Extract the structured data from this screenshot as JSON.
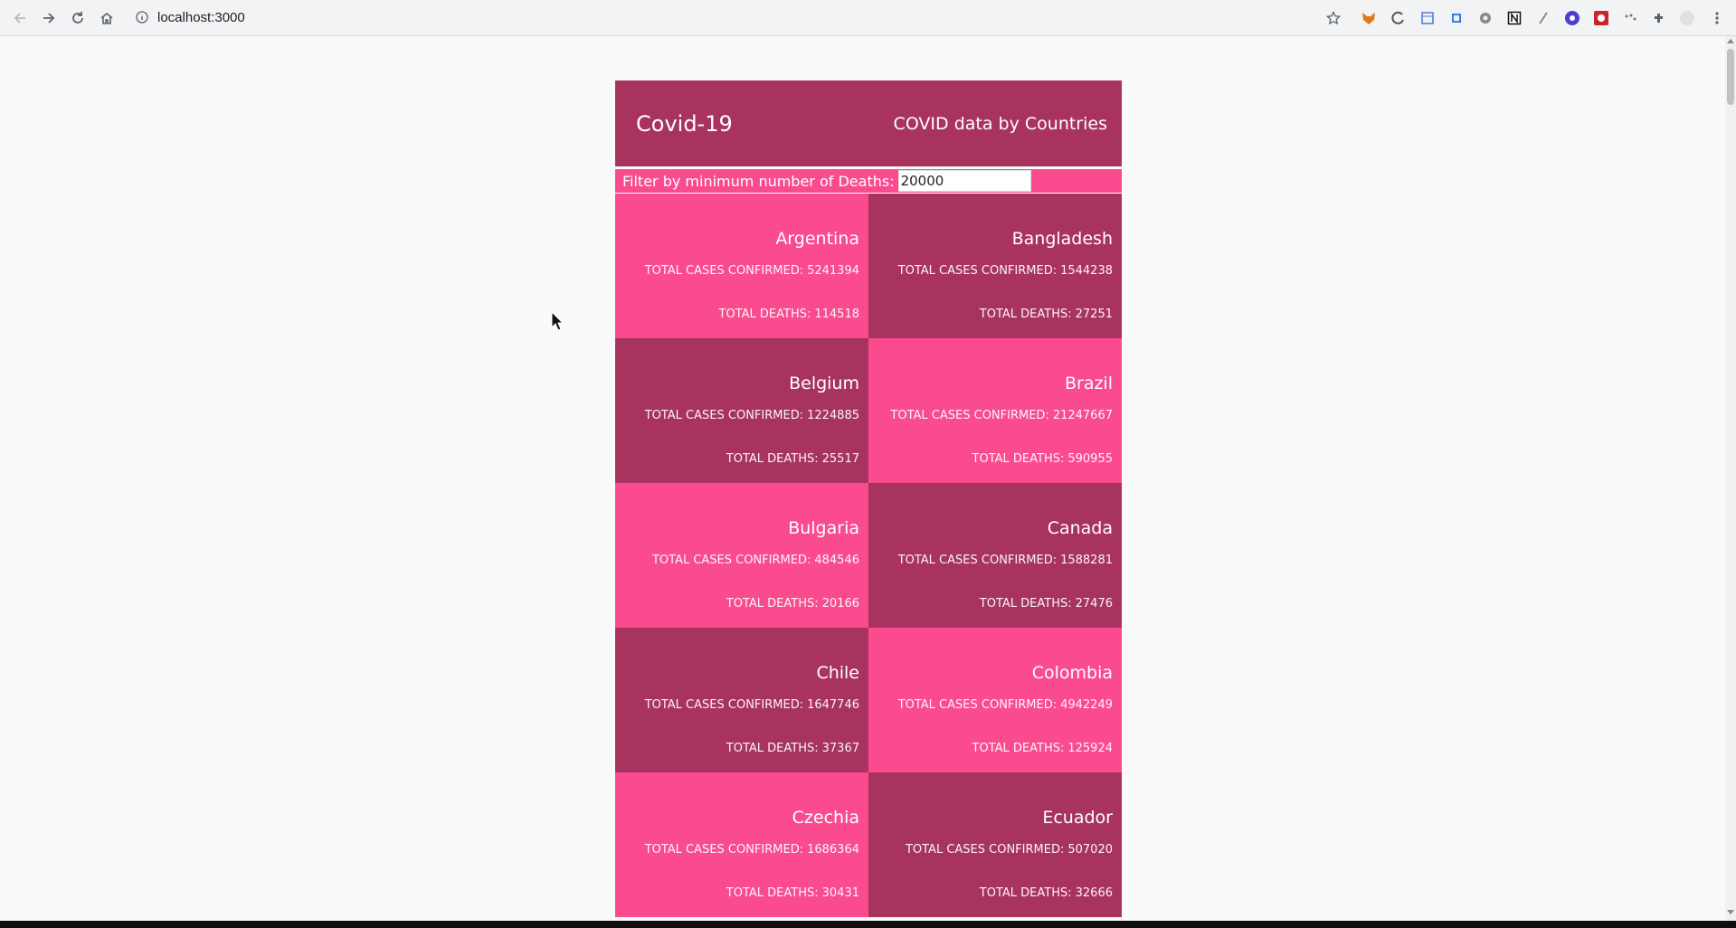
{
  "browser": {
    "url": "localhost:3000",
    "icons": [
      "back-icon",
      "forward-icon",
      "reload-icon",
      "home-icon",
      "site-info-icon",
      "bookmark-star-icon",
      "extensions-icon",
      "menu-icon"
    ]
  },
  "page": {
    "title": "Covid-19",
    "subtitle": "COVID data by Countries",
    "filter": {
      "label": "Filter by minimum number of Deaths:",
      "value": "20000"
    },
    "labels": {
      "cases": "TOTAL CASES CONFIRMED:",
      "deaths": "TOTAL DEATHS:"
    },
    "countries": [
      {
        "name": "Argentina",
        "cases": "5241394",
        "deaths": "114518"
      },
      {
        "name": "Bangladesh",
        "cases": "1544238",
        "deaths": "27251"
      },
      {
        "name": "Belgium",
        "cases": "1224885",
        "deaths": "25517"
      },
      {
        "name": "Brazil",
        "cases": "21247667",
        "deaths": "590955"
      },
      {
        "name": "Bulgaria",
        "cases": "484546",
        "deaths": "20166"
      },
      {
        "name": "Canada",
        "cases": "1588281",
        "deaths": "27476"
      },
      {
        "name": "Chile",
        "cases": "1647746",
        "deaths": "37367"
      },
      {
        "name": "Colombia",
        "cases": "4942249",
        "deaths": "125924"
      },
      {
        "name": "Czechia",
        "cases": "1686364",
        "deaths": "30431"
      },
      {
        "name": "Ecuador",
        "cases": "507020",
        "deaths": "32666"
      }
    ]
  },
  "colors": {
    "dark": "#a8335f",
    "light": "#f94b8e"
  }
}
